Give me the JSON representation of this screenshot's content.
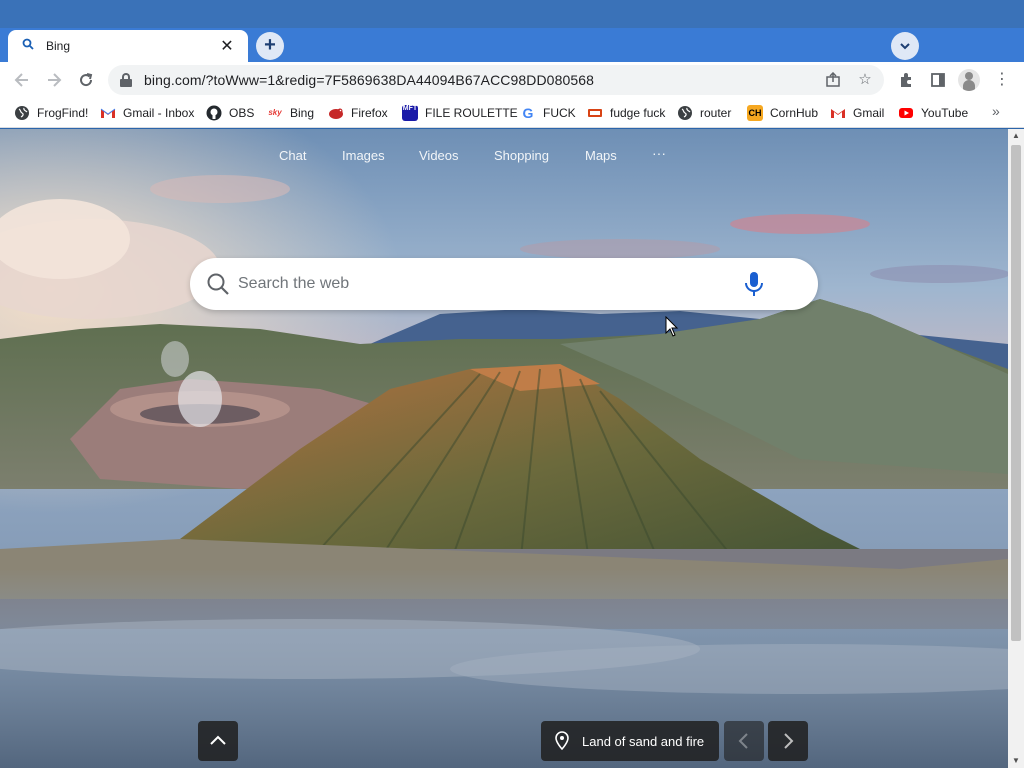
{
  "browser": {
    "tab": {
      "title": "Bing"
    },
    "window_buttons": {
      "minimize": "–",
      "restore": "❐",
      "close": "✕"
    },
    "address": {
      "url": "bing.com/?toWww=1&redig=7F5869638DA44094B67ACC98DD080568"
    },
    "bookmarks": [
      {
        "label": "FrogFind!",
        "icon": "globe-icon",
        "color": "#3c4043"
      },
      {
        "label": "Gmail - Inbox",
        "icon": "gmail-icon",
        "color": "#d93025"
      },
      {
        "label": "OBS",
        "icon": "github-icon",
        "color": "#24292e"
      },
      {
        "label": "Bing",
        "icon": "sky-icon",
        "color": "#e53935"
      },
      {
        "label": "Firefox",
        "icon": "bird-icon",
        "color": "#c62828"
      },
      {
        "label": "FILE ROULETTE",
        "icon": "mft-icon",
        "color": "#1a1aa8"
      },
      {
        "label": "FUCK",
        "icon": "google-icon",
        "color": "#4285f4"
      },
      {
        "label": "fudge fuck",
        "icon": "image-icon",
        "color": "#d84315"
      },
      {
        "label": "router",
        "icon": "globe-icon",
        "color": "#3c4043"
      },
      {
        "label": "CornHub",
        "icon": "ch-icon",
        "color": "#f6a821"
      },
      {
        "label": "Gmail",
        "icon": "gmail-icon",
        "color": "#d93025"
      },
      {
        "label": "YouTube",
        "icon": "youtube-icon",
        "color": "#ff0000"
      }
    ]
  },
  "bing": {
    "nav": [
      "Chat",
      "Images",
      "Videos",
      "Shopping",
      "Maps",
      "···"
    ],
    "search": {
      "placeholder": "Search the web"
    },
    "caption": "Land of sand and fire"
  }
}
